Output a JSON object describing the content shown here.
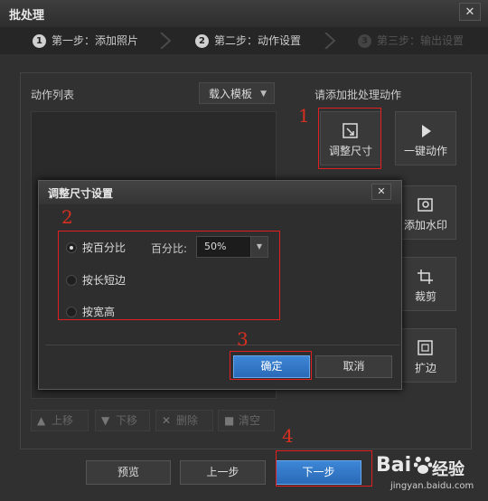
{
  "window": {
    "title": "批处理",
    "close": "✕"
  },
  "steps": [
    {
      "num": "1",
      "label": "第一步：添加照片"
    },
    {
      "num": "2",
      "label": "第二步：动作设置"
    },
    {
      "num": "3",
      "label": "第三步：输出设置"
    }
  ],
  "action_list": {
    "label": "动作列表",
    "template_button": "载入模板",
    "template_arrow": "▼"
  },
  "actions_prompt": "请添加批处理动作",
  "actions": [
    {
      "label": "调整尺寸",
      "icon": "resize-icon"
    },
    {
      "label": "一键动作",
      "icon": "play-icon"
    },
    {
      "label": "添加水印",
      "icon": "watermark-icon"
    },
    {
      "label": "裁剪",
      "icon": "crop-icon"
    },
    {
      "label": "扩边",
      "icon": "expand-icon"
    }
  ],
  "list_toolbar": [
    {
      "glyph": "▲",
      "label": "上移"
    },
    {
      "glyph": "▼",
      "label": "下移"
    },
    {
      "glyph": "✕",
      "label": "删除"
    },
    {
      "glyph": "■",
      "label": "清空"
    }
  ],
  "footer": {
    "preview": "预览",
    "prev": "上一步",
    "next": "下一步"
  },
  "dialog": {
    "title": "调整尺寸设置",
    "close": "✕",
    "options": [
      "按百分比",
      "按长短边",
      "按宽高"
    ],
    "selected_option": "按百分比",
    "percent_label": "百分比:",
    "percent_value": "50%",
    "percent_arrow": "▼",
    "ok": "确定",
    "cancel": "取消"
  },
  "annotations": [
    "1",
    "2",
    "3",
    "4"
  ],
  "watermark": {
    "brand": "Bai",
    "brand2": "经验",
    "url": "jingyan.baidu.com"
  },
  "colors": {
    "accent": "#2a6ab8",
    "annotation": "#e02020"
  }
}
